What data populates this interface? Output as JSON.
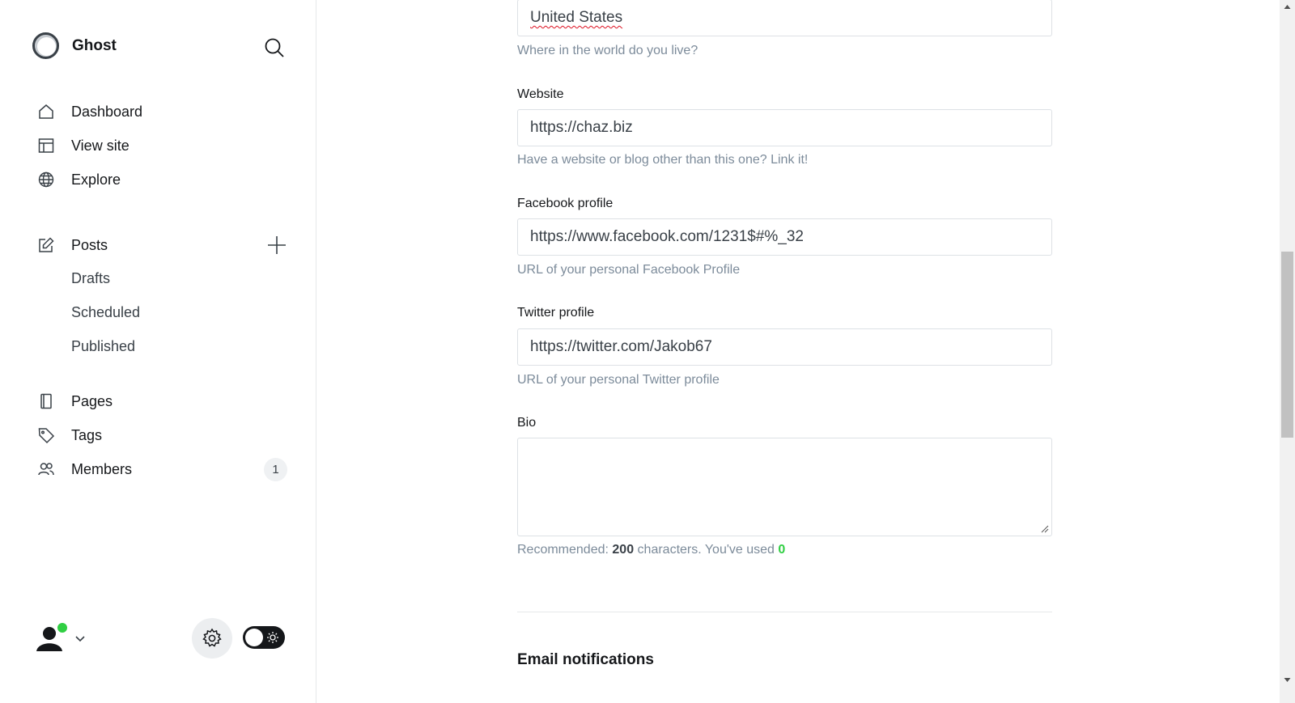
{
  "brand": {
    "name": "Ghost"
  },
  "nav": {
    "primary": [
      {
        "label": "Dashboard",
        "icon": "home-icon"
      },
      {
        "label": "View site",
        "icon": "layout-icon"
      },
      {
        "label": "Explore",
        "icon": "globe-icon"
      }
    ],
    "posts": {
      "label": "Posts",
      "sub": [
        "Drafts",
        "Scheduled",
        "Published"
      ]
    },
    "secondary": [
      {
        "label": "Pages",
        "icon": "pages-icon"
      },
      {
        "label": "Tags",
        "icon": "tag-icon"
      },
      {
        "label": "Members",
        "icon": "members-icon",
        "badge": "1"
      }
    ]
  },
  "form": {
    "location": {
      "value": "United States",
      "help": "Where in the world do you live?"
    },
    "website": {
      "label": "Website",
      "value": "https://chaz.biz",
      "help": "Have a website or blog other than this one? Link it!"
    },
    "facebook": {
      "label": "Facebook profile",
      "value": "https://www.facebook.com/1231$#%_32",
      "help": "URL of your personal Facebook Profile"
    },
    "twitter": {
      "label": "Twitter profile",
      "value": "https://twitter.com/Jakob67",
      "help": "URL of your personal Twitter profile"
    },
    "bio": {
      "label": "Bio",
      "value": "",
      "help_prefix": "Recommended: ",
      "help_limit": "200",
      "help_middle": " characters. You've used ",
      "help_used": "0"
    }
  },
  "section": {
    "email_title": "Email notifications"
  },
  "colors": {
    "accent_green": "#30cf43",
    "text_dark": "#15171a",
    "help_grey": "#7c8b9a"
  }
}
